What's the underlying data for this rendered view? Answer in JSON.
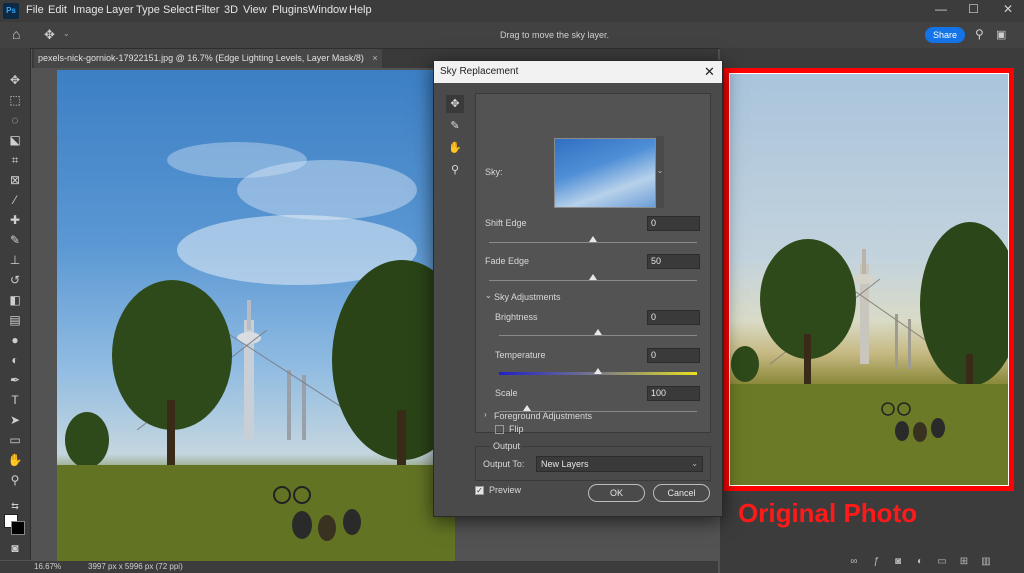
{
  "menubar": {
    "logo": "Ps",
    "items": [
      "File",
      "Edit",
      "Image",
      "Layer",
      "Type",
      "Select",
      "Filter",
      "3D",
      "View",
      "Plugins",
      "Window",
      "Help"
    ],
    "window_controls": [
      "—",
      "☐",
      "✕"
    ]
  },
  "options_bar": {
    "hint": "Drag to move the sky layer.",
    "share_label": "Share"
  },
  "document_tab": {
    "title": "pexels-nick-gorniok-17922151.jpg @ 16.7% (Edge Lighting Levels, Layer Mask/8)",
    "close": "×"
  },
  "status_bar": {
    "zoom": "16.67%",
    "doc_info": "3997 px x 5996 px (72 ppi)"
  },
  "right_panel": {
    "annotation": "Original Photo"
  },
  "dialog": {
    "title": "Sky Replacement",
    "close": "✕",
    "sky_label": "Sky:",
    "shift_edge": {
      "label": "Shift Edge",
      "value": "0",
      "level": 0.5
    },
    "fade_edge": {
      "label": "Fade Edge",
      "value": "50",
      "level": 0.5
    },
    "sky_adjustments": {
      "header": "Sky Adjustments",
      "brightness": {
        "label": "Brightness",
        "value": "0",
        "level": 0.5
      },
      "temperature": {
        "label": "Temperature",
        "value": "0",
        "level": 0.5
      },
      "scale": {
        "label": "Scale",
        "value": "100",
        "level": 0.14
      },
      "flip_label": "Flip",
      "flip_checked": false
    },
    "foreground_adjustments": "Foreground Adjustments",
    "output": {
      "header": "Output",
      "output_to_label": "Output To:",
      "output_to_value": "New Layers"
    },
    "preview_label": "Preview",
    "preview_checked": true,
    "ok_label": "OK",
    "cancel_label": "Cancel"
  },
  "colors": {
    "accent": "#1473e6",
    "annotation_red": "#ff0000",
    "panel": "#535353",
    "menubar": "#3c3c3c"
  }
}
